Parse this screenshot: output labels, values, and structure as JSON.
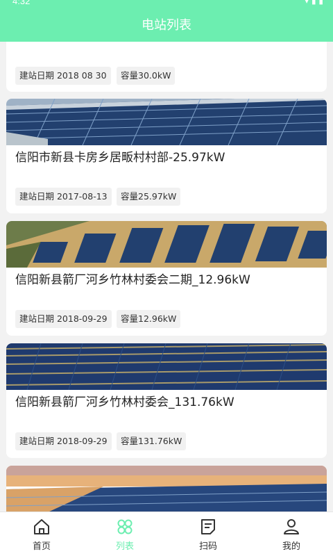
{
  "status": {
    "time": "4:32"
  },
  "header": {
    "title": "电站列表"
  },
  "stations": [
    {
      "title": "",
      "date_label": "建站日期 2018 08 30",
      "capacity_label": "容量30.0kW"
    },
    {
      "title": "信阳市新县卡房乡居畈村村部-25.97kW",
      "date_label": "建站日期 2017-08-13",
      "capacity_label": "容量25.97kW"
    },
    {
      "title": "信阳新县箭厂河乡竹林村委会二期_12.96kW",
      "date_label": "建站日期 2018-09-29",
      "capacity_label": "容量12.96kW"
    },
    {
      "title": "信阳新县箭厂河乡竹林村委会_131.76kW",
      "date_label": "建站日期 2018-09-29",
      "capacity_label": "容量131.76kW"
    }
  ],
  "tabbar": {
    "items": [
      {
        "label": "首页",
        "icon": "home-icon"
      },
      {
        "label": "列表",
        "icon": "grid-icon",
        "active": true
      },
      {
        "label": "扫码",
        "icon": "scan-icon"
      },
      {
        "label": "我的",
        "icon": "user-icon"
      }
    ]
  },
  "colors": {
    "accent": "#6ceeb0",
    "panel": "#1f3a6e"
  }
}
